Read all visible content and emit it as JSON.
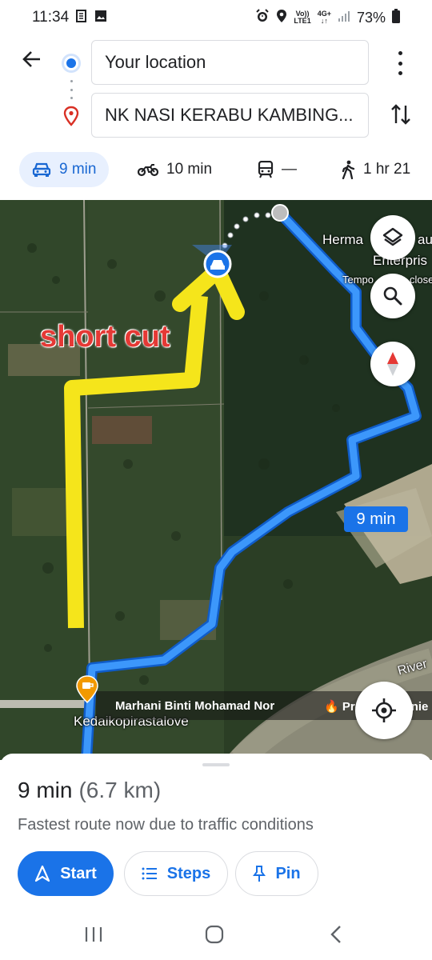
{
  "status_bar": {
    "time": "11:34",
    "network_volte": "Vo))",
    "network_lte": "LTE1",
    "network_4g": "4G+",
    "battery": "73%"
  },
  "directions": {
    "origin": "Your location",
    "destination": "NK NASI KERABU KAMBING...",
    "modes": [
      {
        "icon": "car-icon",
        "label": "9 min",
        "active": true
      },
      {
        "icon": "motorcycle-icon",
        "label": "10 min",
        "active": false
      },
      {
        "icon": "transit-icon",
        "label": "—",
        "active": false
      },
      {
        "icon": "walking-icon",
        "label": "1 hr 21",
        "active": false
      }
    ]
  },
  "map": {
    "labels": {
      "business_1": "Herma",
      "business_1b": "au",
      "business_2": "Enterpris",
      "business_3": "Tempo",
      "business_3b": "close",
      "river": "River",
      "poi": "Kedaikopirastalove"
    },
    "annotation": "short cut",
    "route_chip": "9 min",
    "banner_left": "Marhani Binti Mohamad Nor",
    "banner_right": "Property Genie",
    "controls": [
      "layers-icon",
      "search-icon",
      "compass-icon",
      "recenter-icon"
    ]
  },
  "sheet": {
    "duration": "9 min",
    "distance": "(6.7 km)",
    "reason": "Fastest route now due to traffic conditions",
    "buttons": {
      "start": "Start",
      "steps": "Steps",
      "pin": "Pin"
    }
  },
  "colors": {
    "accent": "#1a73e8",
    "route": "#2f8ff5",
    "annotation_arrow": "#f5e51b",
    "annotation_text": "#e53935"
  }
}
